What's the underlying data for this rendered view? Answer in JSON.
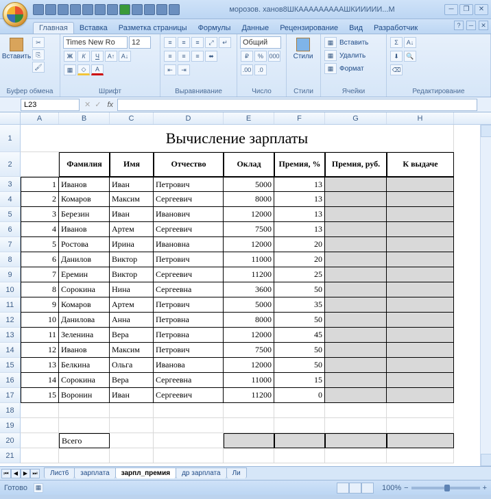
{
  "title": "морозов. ханов8ШКАААААААААШКИИИИИ...М",
  "tabs": [
    "Главная",
    "Вставка",
    "Разметка страницы",
    "Формулы",
    "Данные",
    "Рецензирование",
    "Вид",
    "Разработчик"
  ],
  "activeTab": "Главная",
  "ribbon": {
    "groups": [
      "Буфер обмена",
      "Шрифт",
      "Выравнивание",
      "Число",
      "Стили",
      "Ячейки",
      "Редактирование"
    ],
    "paste": "Вставить",
    "font_name": "Times New Ro",
    "font_size": "12",
    "number_format": "Общий",
    "styles": "Стили",
    "insert": "Вставить",
    "delete": "Удалить",
    "format": "Формат"
  },
  "nameBox": "L23",
  "columns": [
    "A",
    "B",
    "C",
    "D",
    "E",
    "F",
    "G",
    "H"
  ],
  "sheet": {
    "title": "Вычисление зарплаты",
    "headers": [
      "",
      "Фамилия",
      "Имя",
      "Отчество",
      "Оклад",
      "Премия, %",
      "Премия, руб.",
      "К выдаче"
    ],
    "rows": [
      {
        "n": 1,
        "f": "Иванов",
        "i": "Иван",
        "o": "Петрович",
        "ok": "5000",
        "p": "13"
      },
      {
        "n": 2,
        "f": "Комаров",
        "i": "Максим",
        "o": "Сергеевич",
        "ok": "8000",
        "p": "13"
      },
      {
        "n": 3,
        "f": "Березин",
        "i": "Иван",
        "o": "Иванович",
        "ok": "12000",
        "p": "13"
      },
      {
        "n": 4,
        "f": "Иванов",
        "i": "Артем",
        "o": "Сергеевич",
        "ok": "7500",
        "p": "13"
      },
      {
        "n": 5,
        "f": "Ростова",
        "i": "Ирина",
        "o": "Ивановна",
        "ok": "12000",
        "p": "20"
      },
      {
        "n": 6,
        "f": "Данилов",
        "i": "Виктор",
        "o": "Петрович",
        "ok": "11000",
        "p": "20"
      },
      {
        "n": 7,
        "f": "Еремин",
        "i": "Виктор",
        "o": "Сергеевич",
        "ok": "11200",
        "p": "25"
      },
      {
        "n": 8,
        "f": "Сорокина",
        "i": "Нина",
        "o": "Сергеевна",
        "ok": "3600",
        "p": "50"
      },
      {
        "n": 9,
        "f": "Комаров",
        "i": "Артем",
        "o": "Петрович",
        "ok": "5000",
        "p": "35"
      },
      {
        "n": 10,
        "f": "Данилова",
        "i": "Анна",
        "o": "Петровна",
        "ok": "8000",
        "p": "50"
      },
      {
        "n": 11,
        "f": "Зеленина",
        "i": "Вера",
        "o": "Петровна",
        "ok": "12000",
        "p": "45"
      },
      {
        "n": 12,
        "f": "Иванов",
        "i": "Максим",
        "o": "Петрович",
        "ok": "7500",
        "p": "50"
      },
      {
        "n": 13,
        "f": "Белкина",
        "i": "Ольга",
        "o": "Иванова",
        "ok": "12000",
        "p": "50"
      },
      {
        "n": 14,
        "f": "Сорокина",
        "i": "Вера",
        "o": "Сергеевна",
        "ok": "11000",
        "p": "15"
      },
      {
        "n": 15,
        "f": "Воронин",
        "i": "Иван",
        "o": "Сергеевич",
        "ok": "11200",
        "p": "0"
      }
    ],
    "total_label": "Всего"
  },
  "sheetTabs": [
    "Лист6",
    "зарплата",
    "зарпл_премия",
    "др зарплата",
    "Ли"
  ],
  "activeSheet": "зарпл_премия",
  "status": "Готово",
  "zoom": "100%"
}
